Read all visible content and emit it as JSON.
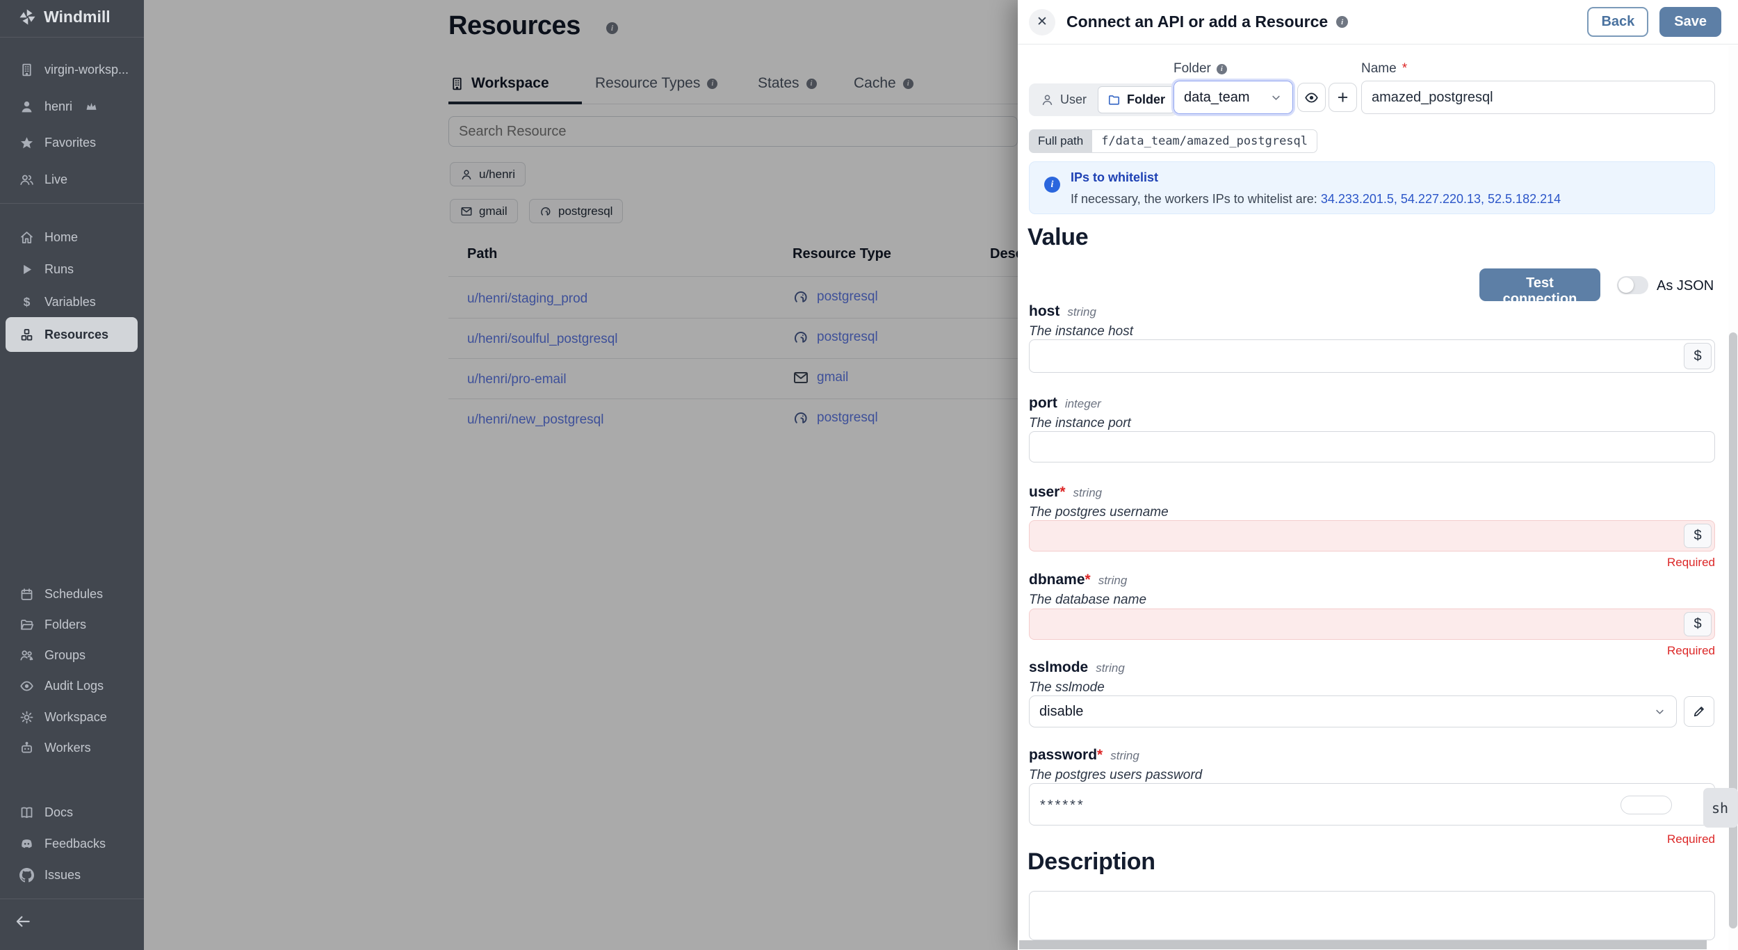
{
  "colors": {
    "accent": "#5d7fa6",
    "sidebar_bg": "#42474f",
    "link": "#5d79e6",
    "error": "#dc2626",
    "info_blue": "#2b55c8"
  },
  "sidebar": {
    "brand": "Windmill",
    "workspace": {
      "label": "virgin-worksp..."
    },
    "user": {
      "label": "henri"
    },
    "favorites": {
      "label": "Favorites"
    },
    "live": {
      "label": "Live"
    },
    "menu": [
      {
        "label": "Home",
        "icon": "home-icon"
      },
      {
        "label": "Runs",
        "icon": "play-icon"
      },
      {
        "label": "Variables",
        "icon": "dollar-icon"
      },
      {
        "label": "Resources",
        "icon": "cubes-icon",
        "active": true
      }
    ],
    "admin": [
      {
        "label": "Schedules",
        "icon": "calendar-icon"
      },
      {
        "label": "Folders",
        "icon": "folder-icon"
      },
      {
        "label": "Groups",
        "icon": "groups-icon"
      },
      {
        "label": "Audit Logs",
        "icon": "eye-icon"
      },
      {
        "label": "Workspace",
        "icon": "gear-icon"
      },
      {
        "label": "Workers",
        "icon": "robot-icon"
      }
    ],
    "footer": [
      {
        "label": "Docs",
        "icon": "book-icon"
      },
      {
        "label": "Feedbacks",
        "icon": "discord-icon"
      },
      {
        "label": "Issues",
        "icon": "github-icon"
      }
    ]
  },
  "main": {
    "title": "Resources",
    "tabs": [
      {
        "label": "Workspace",
        "active": true
      },
      {
        "label": "Resource Types"
      },
      {
        "label": "States"
      },
      {
        "label": "Cache"
      }
    ],
    "search_placeholder": "Search Resource",
    "owner_chip": "u/henri",
    "type_chips": [
      {
        "label": "gmail"
      },
      {
        "label": "postgresql"
      }
    ],
    "table": {
      "columns": [
        "Path",
        "Resource Type",
        "Description"
      ],
      "rows": [
        {
          "path": "u/henri/staging_prod",
          "type": "postgresql"
        },
        {
          "path": "u/henri/soulful_postgresql",
          "type": "postgresql"
        },
        {
          "path": "u/henri/pro-email",
          "type": "gmail"
        },
        {
          "path": "u/henri/new_postgresql",
          "type": "postgresql"
        }
      ]
    }
  },
  "drawer": {
    "title": "Connect an API or add a Resource",
    "back_label": "Back",
    "save_label": "Save",
    "scope": {
      "user_label": "User",
      "folder_label": "Folder",
      "selected": "Folder"
    },
    "folder_field": {
      "label": "Folder",
      "value": "data_team"
    },
    "name_field": {
      "label": "Name",
      "value": "amazed_postgresql"
    },
    "required_mark": "*",
    "full_path": {
      "label": "Full path",
      "value": "f/data_team/amazed_postgresql"
    },
    "info_box": {
      "title": "IPs to whitelist",
      "text": "If necessary, the workers IPs to whitelist are: ",
      "ips": "34.233.201.5, 54.227.220.13, 52.5.182.214"
    },
    "value_heading": "Value",
    "test_connection_label": "Test connection",
    "as_json_label": "As JSON",
    "dollar_label": "$",
    "required_error": "Required",
    "fields": [
      {
        "name": "host",
        "type": "string",
        "description": "The instance host"
      },
      {
        "name": "port",
        "type": "integer",
        "description": "The instance port"
      },
      {
        "name": "user",
        "type": "string",
        "description": "The postgres username"
      },
      {
        "name": "dbname",
        "type": "string",
        "description": "The database name"
      },
      {
        "name": "sslmode",
        "type": "string",
        "description": "The sslmode",
        "value": "disable"
      },
      {
        "name": "password",
        "type": "string",
        "description": "The postgres users password",
        "value": "******"
      }
    ],
    "show_badge": "sh",
    "description_heading": "Description"
  }
}
